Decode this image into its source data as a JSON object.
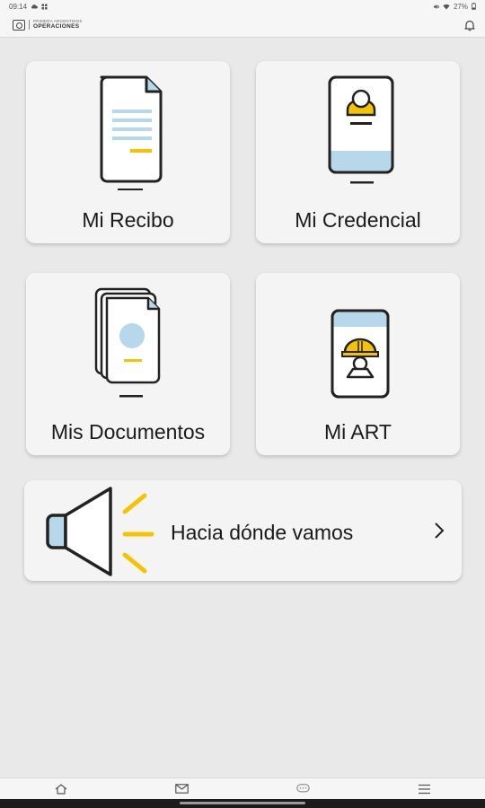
{
  "status_bar": {
    "time": "09:14",
    "battery": "27%",
    "icons": [
      "cloud-icon",
      "notification-icon",
      "mute-icon",
      "wifi-icon",
      "battery-icon"
    ]
  },
  "app_bar": {
    "brand_subtitle": "PRIMERA ARGENTINOS",
    "brand_name": "OPERACIONES",
    "icons": [
      "logo-icon",
      "bell-icon"
    ]
  },
  "tiles": [
    {
      "label": "Mi Recibo",
      "icon": "receipt-phone-icon"
    },
    {
      "label": "Mi Credencial",
      "icon": "credential-phone-icon"
    },
    {
      "label": "Mis Documentos",
      "icon": "documents-phone-icon"
    },
    {
      "label": "Mi ART",
      "icon": "hardhat-worker-phone-icon"
    }
  ],
  "banner": {
    "label": "Hacia dónde vamos",
    "icon": "megaphone-icon",
    "chevron_icon": "chevron-right-icon"
  },
  "bottom_nav": {
    "items": [
      "home-icon",
      "mail-icon",
      "chat-icon",
      "menu-icon"
    ]
  },
  "colors": {
    "accent_yellow": "#f5c400",
    "accent_blue": "#b7d7ea",
    "line_dark": "#222222",
    "tile_bg": "#f4f4f4",
    "page_bg": "#e9e9e9"
  }
}
